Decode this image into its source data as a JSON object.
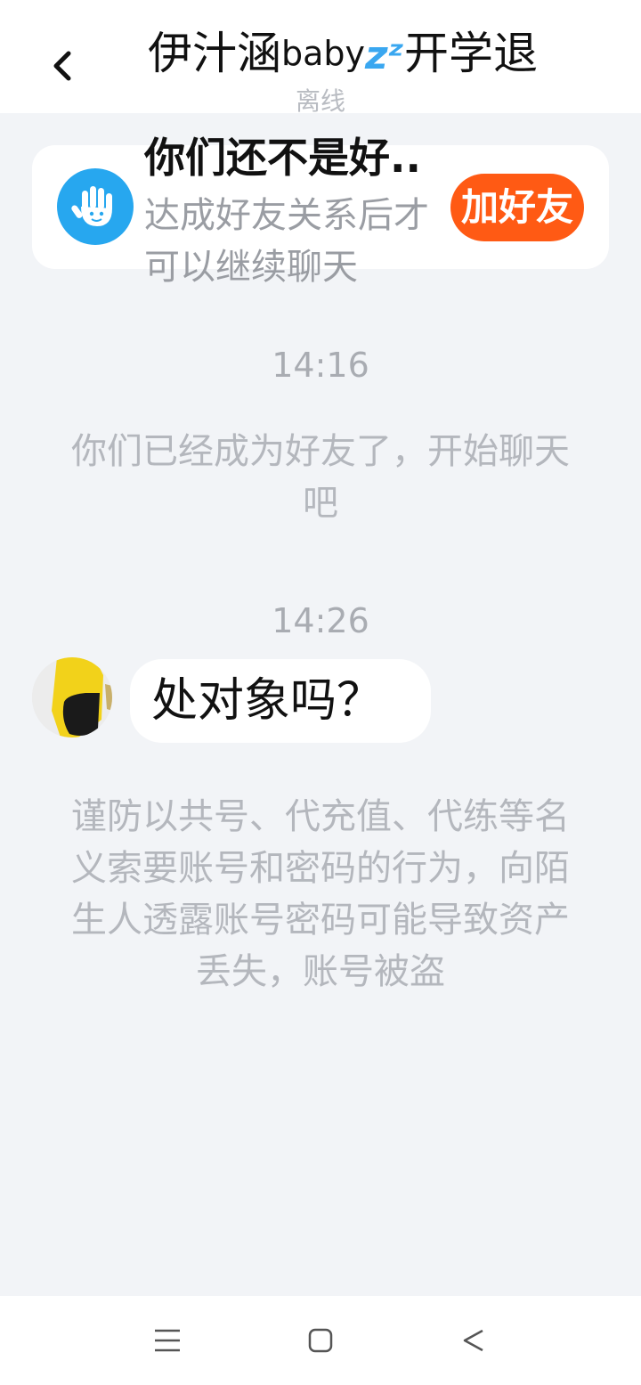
{
  "header": {
    "title_prefix": "伊汁涵",
    "title_baby": "baby",
    "title_zz": "zᶻ",
    "title_suffix": "开学退",
    "status": "离线"
  },
  "friend_card": {
    "title": "你们还不是好..",
    "subtitle": "达成好友关系后才可以继续聊天",
    "add_button": "加好友"
  },
  "messages": {
    "time1": "14:16",
    "system1": "你们已经成为好友了，开始聊天吧",
    "time2": "14:26",
    "bubble_text": "处对象吗？",
    "warning": "谨防以共号、代充值、代练等名义索要账号和密码的行为，向陌生人透露账号密码可能导致资产丢失，账号被盗"
  },
  "colors": {
    "accent_orange": "#ff5a14",
    "hand_blue": "#27a7ef",
    "background": "#f2f4f7"
  },
  "icons": {
    "back": "chevron-left-icon",
    "hand": "waving-hand-icon",
    "menu": "menu-icon",
    "home": "home-square-icon",
    "nav_back": "triangle-back-icon"
  }
}
